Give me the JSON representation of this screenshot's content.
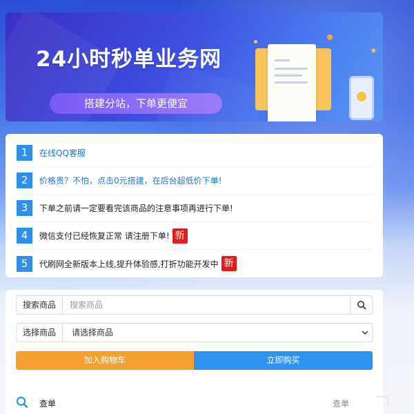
{
  "banner": {
    "title": "24小时秒单业务网",
    "subtitle": "搭建分站，下单更便宜"
  },
  "notices": [
    {
      "num": "1",
      "text": "在线QQ客服",
      "style": "link",
      "new": false
    },
    {
      "num": "2",
      "text": "价格贵？不怕，点击0元搭建，在后台超低价下单!",
      "style": "link",
      "new": false
    },
    {
      "num": "3",
      "text": "下单之前请一定要看完该商品的注意事项再进行下单!",
      "style": "plain",
      "new": false
    },
    {
      "num": "4",
      "text": "微信支付已经恢复正常 请注册下单!",
      "style": "plain",
      "new": true
    },
    {
      "num": "5",
      "text": "代刷网全新版本上线,提升体验感,打折功能开发中",
      "style": "plain",
      "new": true
    }
  ],
  "new_badge_label": "新",
  "order_form": {
    "search_label": "搜索商品",
    "search_placeholder": "搜索商品",
    "select_label": "选择商品",
    "select_value": "请选择商品",
    "add_cart_label": "加入购物车",
    "buy_now_label": "立即购买"
  },
  "query": {
    "label": "查单",
    "right_label": "查单"
  },
  "colors": {
    "accent_blue": "#2f8fe8",
    "cart_orange": "#f6a032",
    "buy_blue": "#2d92f0",
    "new_red": "#e21b1b"
  }
}
